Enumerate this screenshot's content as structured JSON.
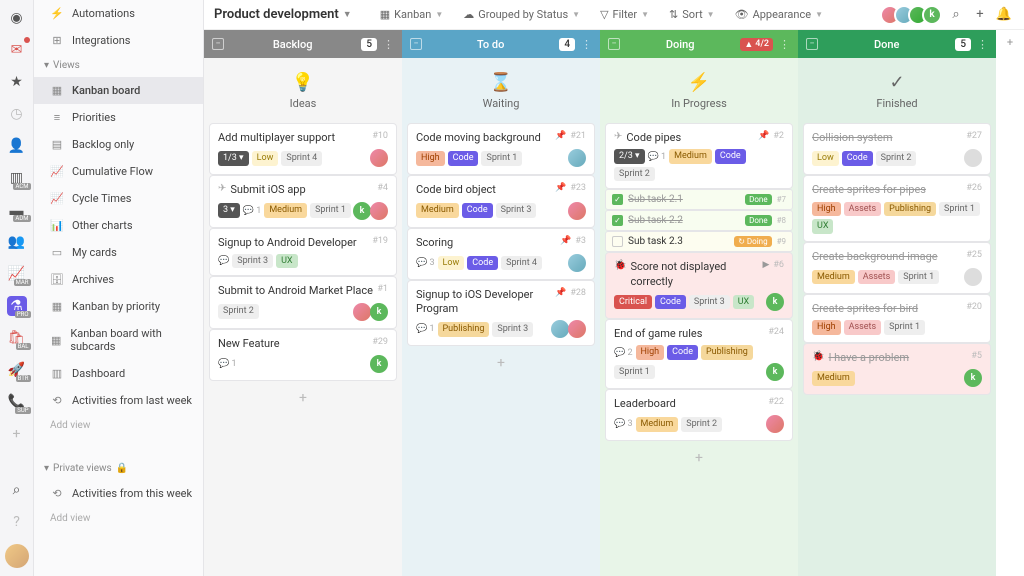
{
  "title": "Product development",
  "toolbar": {
    "view": "Kanban",
    "group": "Grouped by Status",
    "filter": "Filter",
    "sort": "Sort",
    "appearance": "Appearance"
  },
  "rail_badges": {
    "acm": "ACM",
    "adm": "ADM",
    "mar": "MAR",
    "pro": "PRO",
    "bal": "BAL",
    "btr": "BTR",
    "sup": "SUP"
  },
  "sidebar": {
    "automations": "Automations",
    "integrations": "Integrations",
    "views_header": "Views",
    "views": [
      "Kanban board",
      "Priorities",
      "Backlog only",
      "Cumulative Flow",
      "Cycle Times",
      "Other charts",
      "My cards",
      "Archives",
      "Kanban by priority",
      "Kanban board with subcards",
      "Dashboard",
      "Activities from last week"
    ],
    "add_view": "Add view",
    "private_header": "Private views",
    "private": [
      "Activities from this week"
    ]
  },
  "cols": [
    {
      "name": "Backlog",
      "count": "5",
      "sub": "Ideas",
      "icon": "💡"
    },
    {
      "name": "To do",
      "count": "4",
      "sub": "Waiting",
      "icon": "⌛"
    },
    {
      "name": "Doing",
      "count": null,
      "warn": "4/2",
      "sub": "In Progress",
      "icon": "⚡"
    },
    {
      "name": "Done",
      "count": "5",
      "sub": "Finished",
      "icon": "✓"
    }
  ],
  "cards": {
    "backlog": [
      {
        "t": "Add multiplayer support",
        "n": "#10",
        "prog": "1/3",
        "tags": [
          [
            "Low",
            "t-low"
          ],
          [
            "Sprint 4",
            "t-sprint"
          ]
        ],
        "av": [
          "av1"
        ]
      },
      {
        "t": "Submit iOS app",
        "n": "#4",
        "rk": "✈",
        "prog": "3",
        "cm": "1",
        "tags": [
          [
            "Medium",
            "t-med"
          ],
          [
            "Sprint 1",
            "t-sprint"
          ]
        ],
        "av": [
          "avk",
          "av1"
        ]
      },
      {
        "t": "Signup to Android Developer",
        "n": "#19",
        "cm": "",
        "tags": [
          [
            "Sprint 3",
            "t-sprint"
          ],
          [
            "UX",
            "t-ux"
          ]
        ]
      },
      {
        "t": "Submit to Android Market Place",
        "n": "#1",
        "tags": [
          [
            "Sprint 2",
            "t-sprint"
          ]
        ],
        "av": [
          "av1",
          "avk"
        ]
      },
      {
        "t": "New Feature",
        "n": "#29",
        "cm": "1",
        "av": [
          "avk"
        ]
      }
    ],
    "todo": [
      {
        "t": "Code moving background",
        "n": "#21",
        "pin": true,
        "tags": [
          [
            "High",
            "t-high"
          ],
          [
            "Code",
            "t-code"
          ],
          [
            "Sprint 1",
            "t-sprint"
          ]
        ],
        "av": [
          "av2"
        ]
      },
      {
        "t": "Code bird object",
        "n": "#23",
        "pin": true,
        "tags": [
          [
            "Medium",
            "t-med"
          ],
          [
            "Code",
            "t-code"
          ],
          [
            "Sprint 3",
            "t-sprint"
          ]
        ],
        "av": [
          "av1"
        ]
      },
      {
        "t": "Scoring",
        "n": "#3",
        "pin": true,
        "cm": "3",
        "tags": [
          [
            "Low",
            "t-low"
          ],
          [
            "Code",
            "t-code"
          ],
          [
            "Sprint 4",
            "t-sprint"
          ]
        ],
        "av": [
          "av2"
        ]
      },
      {
        "t": "Signup to iOS Developer Program",
        "n": "#28",
        "pin": true,
        "cm": "1",
        "tags": [
          [
            "Publishing",
            "t-pub"
          ],
          [
            "Sprint 3",
            "t-sprint"
          ]
        ],
        "av": [
          "av2",
          "av1"
        ]
      }
    ],
    "doing": [
      {
        "t": "Code pipes",
        "n": "#2",
        "rk": "✈",
        "pin": true,
        "prog": "2/3",
        "cm": "1",
        "tags": [
          [
            "Medium",
            "t-med"
          ],
          [
            "Code",
            "t-code"
          ],
          [
            "Sprint 2",
            "t-sprint"
          ]
        ],
        "subs": [
          {
            "t": "Sub task 2.1",
            "done": true,
            "b": "Done",
            "n": "#7"
          },
          {
            "t": "Sub task 2.2",
            "done": true,
            "b": "Done",
            "n": "#8"
          },
          {
            "t": "Sub task 2.3",
            "done": false,
            "b": "Doing",
            "n": "#9"
          }
        ]
      },
      {
        "t": "Score not displayed correctly",
        "n": "#6",
        "cls": "red",
        "rk": "🐞",
        "run": true,
        "tags": [
          [
            "Critical",
            "t-crit"
          ],
          [
            "Code",
            "t-code"
          ],
          [
            "Sprint 3",
            "t-sprint"
          ],
          [
            "UX",
            "t-ux"
          ]
        ],
        "av": [
          "avk"
        ]
      },
      {
        "t": "End of game rules",
        "n": "#24",
        "cm": "2",
        "tags": [
          [
            "High",
            "t-high"
          ],
          [
            "Code",
            "t-code"
          ],
          [
            "Publishing",
            "t-pub"
          ],
          [
            "Sprint 1",
            "t-sprint"
          ]
        ],
        "av": [
          "avk"
        ]
      },
      {
        "t": "Leaderboard",
        "n": "#22",
        "cm": "3",
        "tags": [
          [
            "Medium",
            "t-med"
          ],
          [
            "Sprint 2",
            "t-sprint"
          ]
        ],
        "av": [
          "av1"
        ]
      }
    ],
    "done": [
      {
        "t": "Collision system",
        "n": "#27",
        "done": true,
        "tags": [
          [
            "Low",
            "t-low"
          ],
          [
            "Code",
            "t-code"
          ],
          [
            "Sprint 2",
            "t-sprint"
          ]
        ],
        "av": [
          "av0"
        ]
      },
      {
        "t": "Create sprites for pipes",
        "n": "#26",
        "done": true,
        "tags": [
          [
            "High",
            "t-high"
          ],
          [
            "Assets",
            "t-assets"
          ],
          [
            "Publishing",
            "t-pub"
          ],
          [
            "Sprint 1",
            "t-sprint"
          ],
          [
            "UX",
            "t-ux"
          ]
        ]
      },
      {
        "t": "Create background image",
        "n": "#25",
        "done": true,
        "tags": [
          [
            "Medium",
            "t-med"
          ],
          [
            "Assets",
            "t-assets"
          ],
          [
            "Sprint 1",
            "t-sprint"
          ]
        ],
        "av": [
          "av0"
        ]
      },
      {
        "t": "Create sprites for bird",
        "n": "#20",
        "done": true,
        "tags": [
          [
            "High",
            "t-high"
          ],
          [
            "Assets",
            "t-assets"
          ],
          [
            "Sprint 1",
            "t-sprint"
          ]
        ]
      },
      {
        "t": "I have a problem",
        "n": "#5",
        "done": true,
        "cls": "red",
        "rk": "🐞",
        "tags": [
          [
            "Medium",
            "t-med"
          ]
        ],
        "av": [
          "avk"
        ]
      }
    ]
  }
}
